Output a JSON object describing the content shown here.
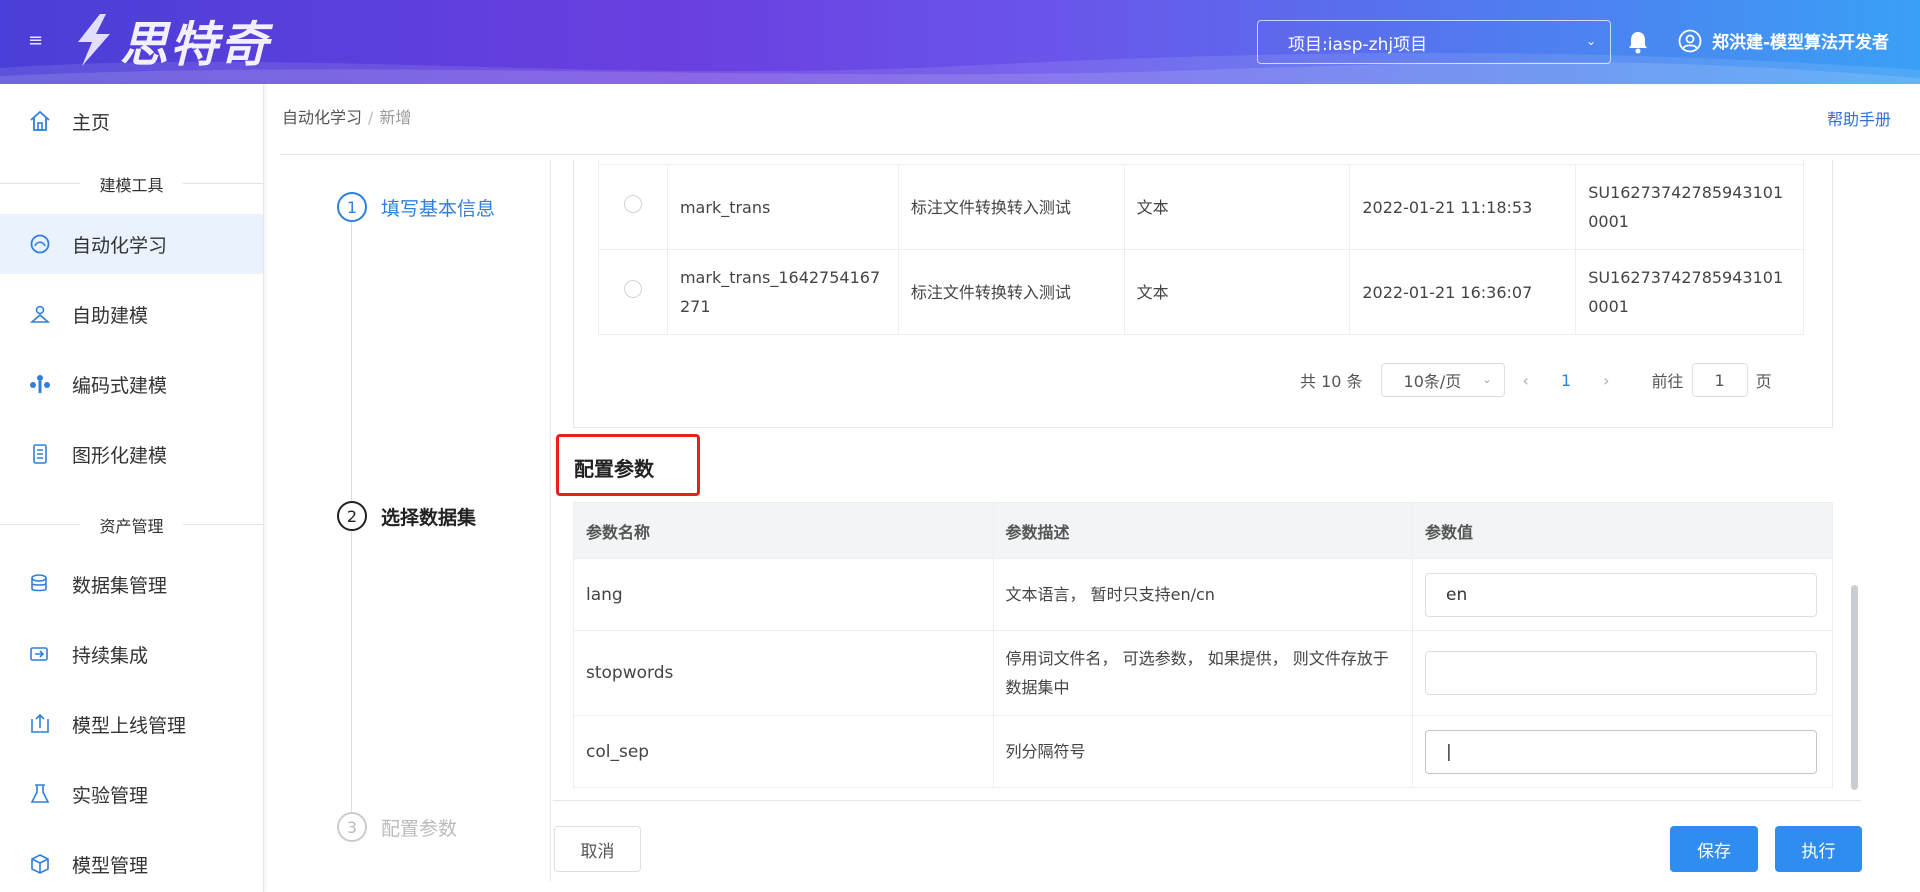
{
  "header": {
    "logo_text": "思特奇",
    "project_select": "项目:iasp-zhj项目",
    "user": "郑洪建-模型算法开发者"
  },
  "sidebar": {
    "home": "主页",
    "group_modeling": "建模工具",
    "items_modeling": [
      "自动化学习",
      "自助建模",
      "编码式建模",
      "图形化建模"
    ],
    "group_assets": "资产管理",
    "items_assets": [
      "数据集管理",
      "持续集成",
      "模型上线管理",
      "实验管理",
      "模型管理"
    ]
  },
  "breadcrumb": {
    "parent": "自动化学习",
    "sep": "/",
    "current": "新增"
  },
  "help_link": "帮助手册",
  "steps": [
    {
      "num": "1",
      "label": "填写基本信息"
    },
    {
      "num": "2",
      "label": "选择数据集"
    },
    {
      "num": "3",
      "label": "配置参数"
    }
  ],
  "dataset_rows": [
    {
      "name": "mark_trans",
      "desc": "标注文件转换转入测试",
      "type": "文本",
      "time": "2022-01-21 11:18:53",
      "id": "SU162737427859431010001"
    },
    {
      "name": "mark_trans_1642754167271",
      "desc": "标注文件转换转入测试",
      "type": "文本",
      "time": "2022-01-21 16:36:07",
      "id": "SU162737427859431010001"
    }
  ],
  "pager": {
    "total": "共 10 条",
    "size": "10条/页",
    "page": "1",
    "goto": "前往",
    "goto_value": "1",
    "page_suffix": "页"
  },
  "config": {
    "title": "配置参数",
    "headers": [
      "参数名称",
      "参数描述",
      "参数值"
    ],
    "rows": [
      {
        "name": "lang",
        "desc": "文本语言， 暂时只支持en/cn",
        "value": "en"
      },
      {
        "name": "stopwords",
        "desc": "停用词文件名， 可选参数， 如果提供， 则文件存放于数据集中",
        "value": ""
      },
      {
        "name": "col_sep",
        "desc": "列分隔符号",
        "value": "|"
      }
    ]
  },
  "buttons": {
    "cancel": "取消",
    "save": "保存",
    "run": "执行"
  },
  "colors": {
    "accent": "#2f8cf0",
    "active_nav_bg": "#e9f2fd",
    "highlight_border": "#e52020"
  }
}
